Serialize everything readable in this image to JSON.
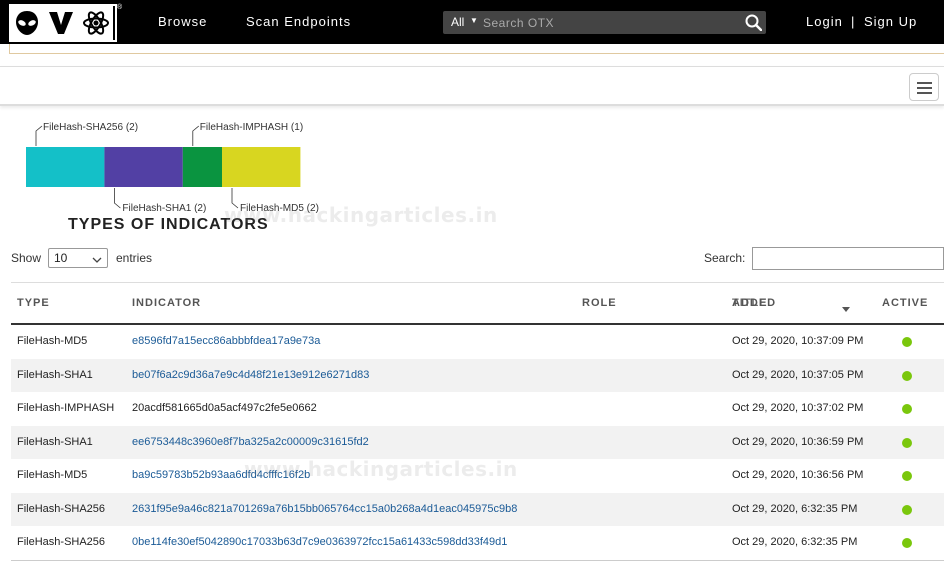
{
  "header": {
    "nav": {
      "browse": "Browse",
      "scan": "Scan Endpoints"
    },
    "search": {
      "scope": "All",
      "placeholder": "Search OTX"
    },
    "auth": {
      "login": "Login",
      "separator": "|",
      "signup": "Sign Up"
    },
    "logo_tm": "®"
  },
  "chart_data": {
    "type": "bar",
    "title": "TYPES OF INDICATORS",
    "orientation": "horizontal-stacked",
    "categories": [
      "FileHash-SHA256",
      "FileHash-SHA1",
      "FileHash-IMPHASH",
      "FileHash-MD5"
    ],
    "values": [
      2,
      2,
      1,
      2
    ],
    "labels": [
      "FileHash-SHA256 (2)",
      "FileHash-SHA1 (2)",
      "FileHash-IMPHASH (1)",
      "FileHash-MD5 (2)"
    ],
    "colors": [
      "#14c0c8",
      "#5240a4",
      "#0a9440",
      "#d8d620"
    ],
    "label_positions": [
      "top",
      "bottom",
      "top",
      "bottom"
    ]
  },
  "watermark": "www.hackingarticles.in",
  "table": {
    "show_label": "Show",
    "page_size": "10",
    "entries_label": "entries",
    "search_label": "Search:",
    "columns": {
      "type": "TYPE",
      "indicator": "INDICATOR",
      "role": "ROLE",
      "title": "TITLE",
      "added": "ADDED",
      "active": "ACTIVE"
    },
    "rows": [
      {
        "type": "FileHash-MD5",
        "indicator": "e8596fd7a15ecc86abbbfdea17a9e73a",
        "added": "Oct 29, 2020, 10:37:09 PM",
        "link": true
      },
      {
        "type": "FileHash-SHA1",
        "indicator": "be07f6a2c9d36a7e9c4d48f21e13e912e6271d83",
        "added": "Oct 29, 2020, 10:37:05 PM",
        "link": true
      },
      {
        "type": "FileHash-IMPHASH",
        "indicator": "20acdf581665d0a5acf497c2fe5e0662",
        "added": "Oct 29, 2020, 10:37:02 PM",
        "link": false
      },
      {
        "type": "FileHash-SHA1",
        "indicator": "ee6753448c3960e8f7ba325a2c00009c31615fd2",
        "added": "Oct 29, 2020, 10:36:59 PM",
        "link": true
      },
      {
        "type": "FileHash-MD5",
        "indicator": "ba9c59783b52b93aa6dfd4cfffc16f2b",
        "added": "Oct 29, 2020, 10:36:56 PM",
        "link": true
      },
      {
        "type": "FileHash-SHA256",
        "indicator": "2631f95e9a46c821a701269a76b15bb065764cc15a0b268a4d1eac045975c9b8",
        "added": "Oct 29, 2020, 6:32:35 PM",
        "link": true
      },
      {
        "type": "FileHash-SHA256",
        "indicator": "0be114fe30ef5042890c17033b63d7c9e0363972fcc15a61433c598dd33f49d1",
        "added": "Oct 29, 2020, 6:32:35 PM",
        "link": true
      }
    ],
    "active_color": "#7ac70c"
  }
}
